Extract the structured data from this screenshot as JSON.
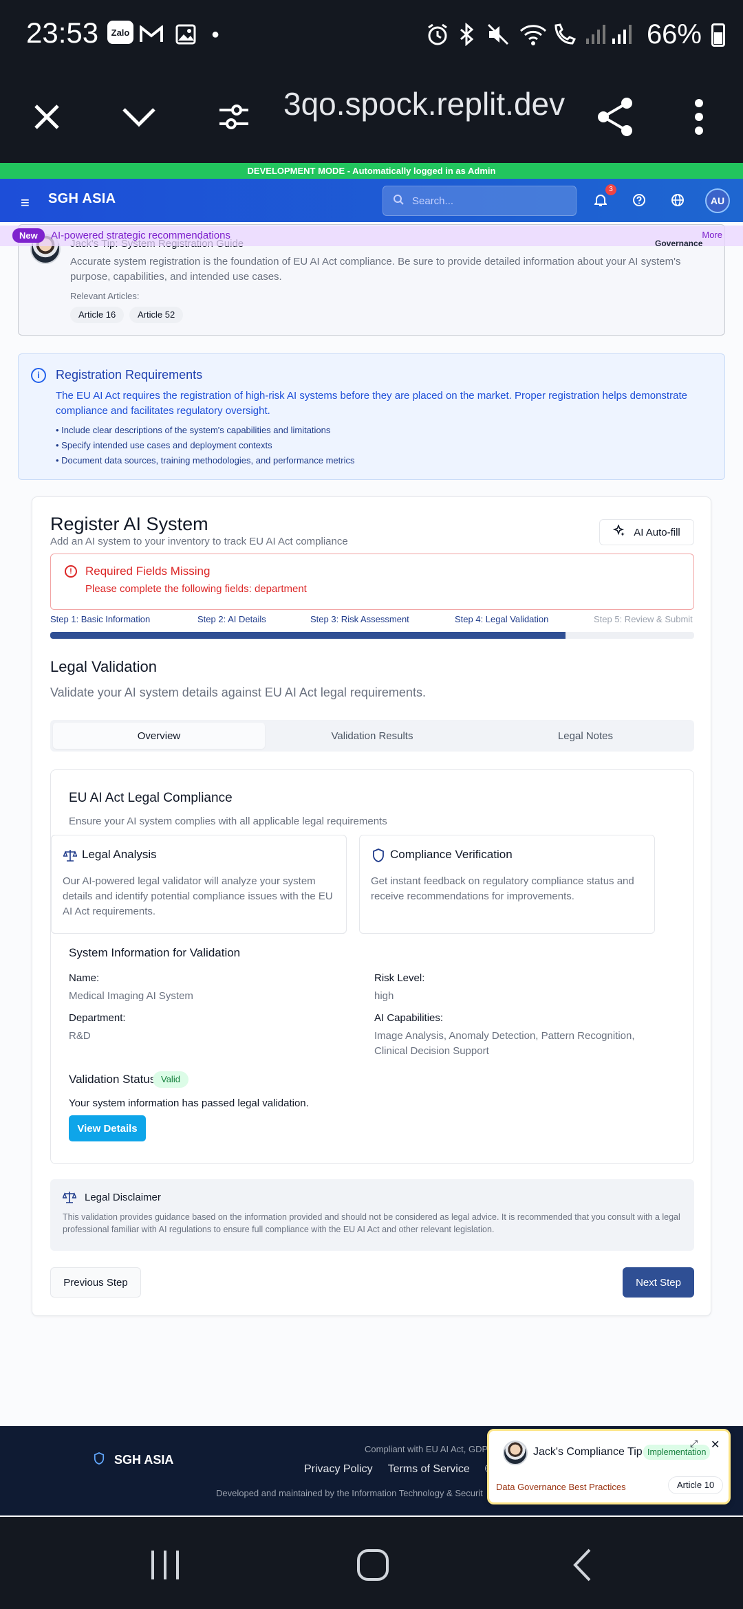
{
  "status_bar": {
    "time": "23:53",
    "zalo": "Zalo",
    "battery": "66%",
    "icons": [
      "zalo-icon",
      "gmail-icon",
      "gallery-icon",
      "dot-icon",
      "alarm-icon",
      "bluetooth-icon",
      "mute-icon",
      "wifi-icon",
      "wifi-call-icon",
      "signal-icon",
      "signal-icon",
      "battery-icon"
    ]
  },
  "browser": {
    "url": "3qo.spock.replit.dev",
    "icons": [
      "close-icon",
      "chevron-down-icon",
      "tune-icon",
      "share-icon",
      "more-vert-icon"
    ]
  },
  "dev_banner": "DEVELOPMENT MODE - Automatically logged in as Admin",
  "navbar": {
    "brand": "SGH ASIA",
    "search_placeholder": "Search...",
    "notification_count": "3",
    "avatar": "AU"
  },
  "promo": {
    "badge": "New",
    "text": "AI-powered strategic recommendations",
    "more": "More"
  },
  "tip": {
    "title": "Jack's Tip: System Registration Guide",
    "tag": "Governance",
    "body": "Accurate system registration is the foundation of EU AI Act compliance. Be sure to provide detailed information about your AI system's purpose, capabilities, and intended use cases.",
    "relevant_label": "Relevant Articles:",
    "articles": [
      "Article 16",
      "Article 52"
    ]
  },
  "requirements": {
    "title": "Registration Requirements",
    "body": "The EU AI Act requires the registration of high-risk AI systems before they are placed on the market. Proper registration helps demonstrate compliance and facilitates regulatory oversight.",
    "items": [
      "• Include clear descriptions of the system's capabilities and limitations",
      "• Specify intended use cases and deployment contexts",
      "• Document data sources, training methodologies, and performance metrics"
    ]
  },
  "register": {
    "title": "Register AI System",
    "subtitle": "Add an AI system to your inventory to track EU AI Act compliance",
    "autofill": "AI Auto-fill",
    "error_title": "Required Fields Missing",
    "error_text": "Please complete the following fields: department",
    "steps": [
      "Step 1: Basic Information",
      "Step 2: AI Details",
      "Step 3: Risk Assessment",
      "Step 4: Legal Validation",
      "Step 5: Review & Submit"
    ],
    "progress": 0.8
  },
  "legal": {
    "title": "Legal Validation",
    "subtitle": "Validate your AI system details against EU AI Act legal requirements.",
    "tabs": [
      "Overview",
      "Validation Results",
      "Legal Notes"
    ],
    "compliance_title": "EU AI Act Legal Compliance",
    "compliance_sub": "Ensure your AI system complies with all applicable legal requirements",
    "cards": [
      {
        "title": "Legal Analysis",
        "body": "Our AI-powered legal validator will analyze your system details and identify potential compliance issues with the EU AI Act requirements."
      },
      {
        "title": "Compliance Verification",
        "body": "Get instant feedback on regulatory compliance status and receive recommendations for improvements."
      }
    ],
    "sysinfo_title": "System Information for Validation",
    "fields": {
      "name_label": "Name:",
      "name": "Medical Imaging AI System",
      "risk_label": "Risk Level:",
      "risk": "high",
      "dept_label": "Department:",
      "dept": "R&D",
      "cap_label": "AI Capabilities:",
      "cap": "Image Analysis, Anomaly Detection, Pattern Recognition, Clinical Decision Support"
    },
    "status_label": "Validation Status:",
    "status": "Valid",
    "status_text": "Your system information has passed legal validation.",
    "view_details": "View Details",
    "disclaimer_title": "Legal Disclaimer",
    "disclaimer_body": "This validation provides guidance based on the information provided and should not be considered as legal advice. It is recommended that you consult with a legal professional familiar with AI regulations to ensure full compliance with the EU AI Act and other relevant legislation.",
    "prev": "Previous Step",
    "next": "Next Step"
  },
  "footer": {
    "brand": "SGH ASIA",
    "compliance": "Compliant with EU AI Act, GDP",
    "links": [
      "Privacy Policy",
      "Terms of Service",
      "© 2"
    ],
    "developed": "Developed and maintained by the Information Technology & Securit"
  },
  "popup": {
    "title": "Jack's Compliance Tip",
    "tag": "Implementation",
    "link": "Data Governance Best Practices",
    "article": "Article 10"
  },
  "colors": {
    "primary": "#1d4ed8",
    "navy": "#2f4f94",
    "error": "#dc2626",
    "success": "#15803d",
    "dev": "#22c55e"
  }
}
